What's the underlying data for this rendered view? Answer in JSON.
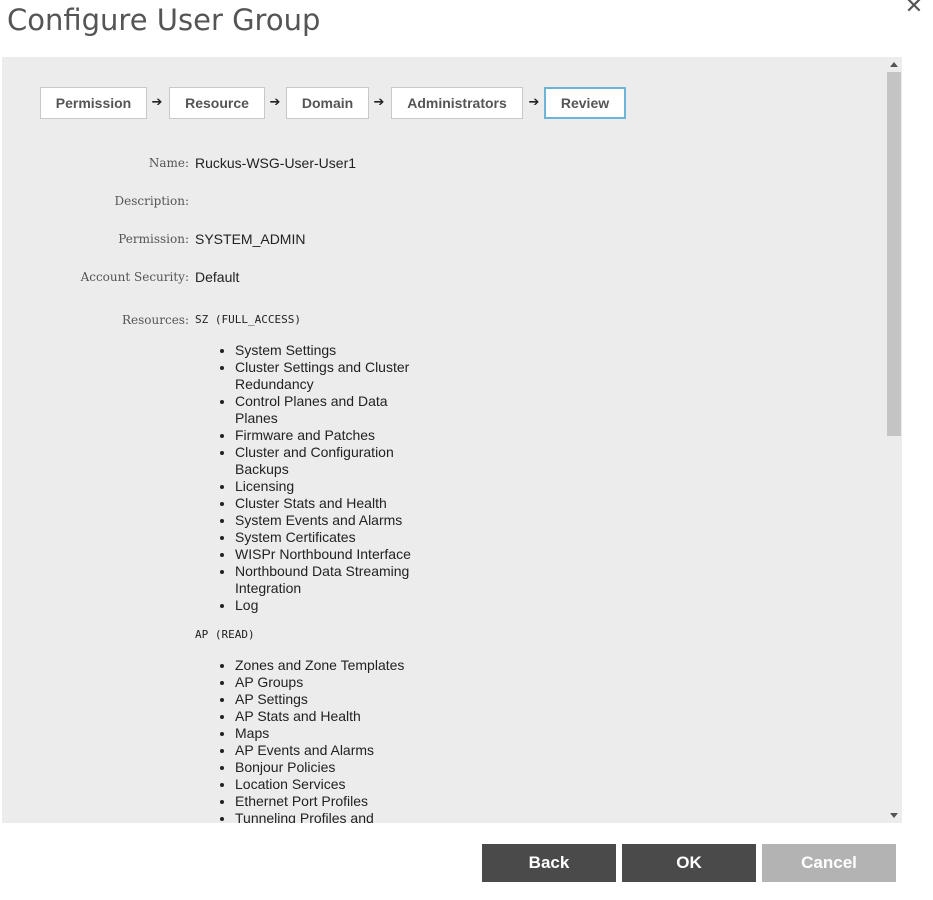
{
  "dialog": {
    "title": "Configure User Group",
    "close_glyph": "✕"
  },
  "steps": [
    {
      "label": "Permission"
    },
    {
      "label": "Resource"
    },
    {
      "label": "Domain"
    },
    {
      "label": "Administrators"
    },
    {
      "label": "Review",
      "active": true
    }
  ],
  "step_arrow_glyph": "➔",
  "review": {
    "name_label": "Name:",
    "name_value": "Ruckus-WSG-User-User1",
    "description_label": "Description:",
    "description_value": "",
    "permission_label": "Permission:",
    "permission_value": "SYSTEM_ADMIN",
    "account_security_label": "Account Security:",
    "account_security_value": "Default",
    "resources_label": "Resources:"
  },
  "resources": [
    {
      "heading": "SZ (FULL_ACCESS)",
      "items": [
        "System Settings",
        "Cluster Settings and Cluster Redundancy",
        "Control Planes and Data Planes",
        "Firmware and Patches",
        "Cluster and Configuration Backups",
        "Licensing",
        "Cluster Stats and Health",
        "System Events and Alarms",
        "System Certificates",
        "WISPr Northbound Interface",
        "Northbound Data Streaming Integration",
        "Log"
      ]
    },
    {
      "heading": "AP (READ)",
      "items": [
        "Zones and Zone Templates",
        "AP Groups",
        "AP Settings",
        "AP Stats and Health",
        "Maps",
        "AP Events and Alarms",
        "Bonjour Policies",
        "Location Services",
        "Ethernet Port Profiles",
        "Tunneling Profiles and"
      ]
    }
  ],
  "footer": {
    "back_label": "Back",
    "ok_label": "OK",
    "cancel_label": "Cancel"
  },
  "colors": {
    "panel_bg": "#ececec",
    "active_step_border": "#6cb4d8",
    "primary_button": "#4a4a4a",
    "disabled_button": "#b3b3b3"
  }
}
